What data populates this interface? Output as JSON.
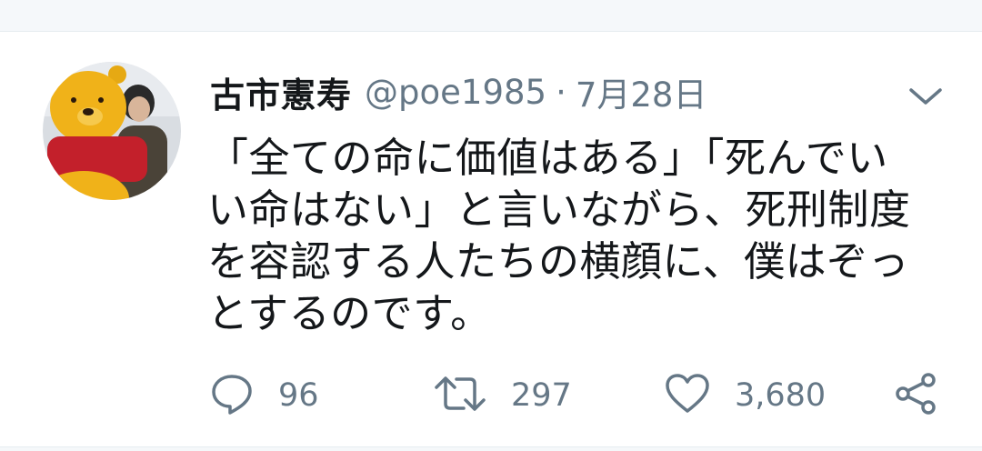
{
  "tweet": {
    "author_name": "古市憲寿",
    "handle": "@poe1985",
    "separator": "·",
    "date": "7月28日",
    "text": "「全ての命に価値はある」「死んでい\nい命はない」と言いながら、死刑制度\nを容認する人たちの横顔に、僕はぞっ\nとするのです。"
  },
  "actions": {
    "reply_count": "96",
    "retweet_count": "297",
    "like_count": "3,680"
  },
  "icons": {
    "more": "chevron-down-icon",
    "reply": "speech-bubble-icon",
    "retweet": "retweet-icon",
    "like": "heart-icon",
    "share": "share-icon"
  },
  "colors": {
    "text_primary": "#14171a",
    "text_secondary": "#657786",
    "background": "#ffffff",
    "page_background": "#f5f8fa"
  }
}
